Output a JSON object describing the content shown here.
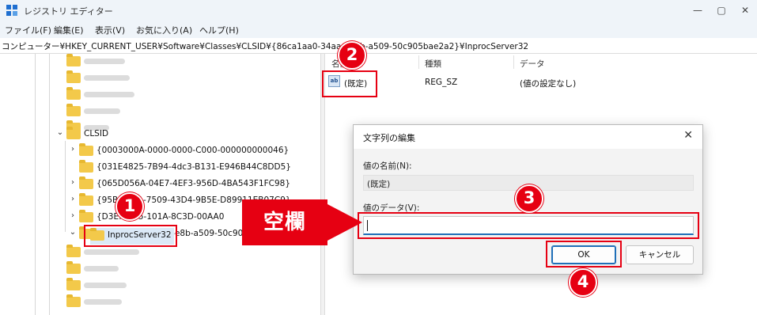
{
  "window": {
    "title": "レジストリ エディター",
    "controls": [
      "—",
      "▢",
      "✕"
    ]
  },
  "menu": [
    "ファイル(F)",
    "編集(E)",
    "表示(V)",
    "お気に入り(A)",
    "ヘルプ(H)"
  ],
  "address": {
    "path": "コンピューター¥HKEY_CURRENT_USER¥Software¥Classes¥CLSID¥{86ca1aa0-34aa-4e8b-a509-50c905bae2a2}¥InprocServer32"
  },
  "tree": {
    "clsid_label": "CLSID",
    "keys": [
      "{0003000A-0000-0000-C000-000000000046}",
      "{031E4825-7B94-4dc3-B131-E946B44C8DD5}",
      "{065D056A-04E7-4EF3-956D-4BA543F1FC98}",
      "{95BD0...A-7509-43D4-9B5E-D89911EB07C9}",
      "{D3E...D75-101A-8C3D-00AA0",
      "{86ca1aa0-34aa-4e8b-a509-50c905b"
    ],
    "selected_child": "InprocServer32"
  },
  "values": {
    "columns": [
      "名前",
      "種類",
      "データ"
    ],
    "rows": [
      {
        "name": "(既定)",
        "type": "REG_SZ",
        "data": "(値の設定なし)",
        "icon": "reg-sz-icon"
      }
    ]
  },
  "dialog": {
    "title": "文字列の編集",
    "name_label": "値の名前(N):",
    "name_value": "(既定)",
    "data_label": "値のデータ(V):",
    "data_value": "",
    "ok_label": "OK",
    "cancel_label": "キャンセル"
  },
  "annotations": {
    "step1": "1",
    "step2": "2",
    "step3": "3",
    "step4": "4",
    "callout": "空欄",
    "accent_color": "#e60012"
  }
}
